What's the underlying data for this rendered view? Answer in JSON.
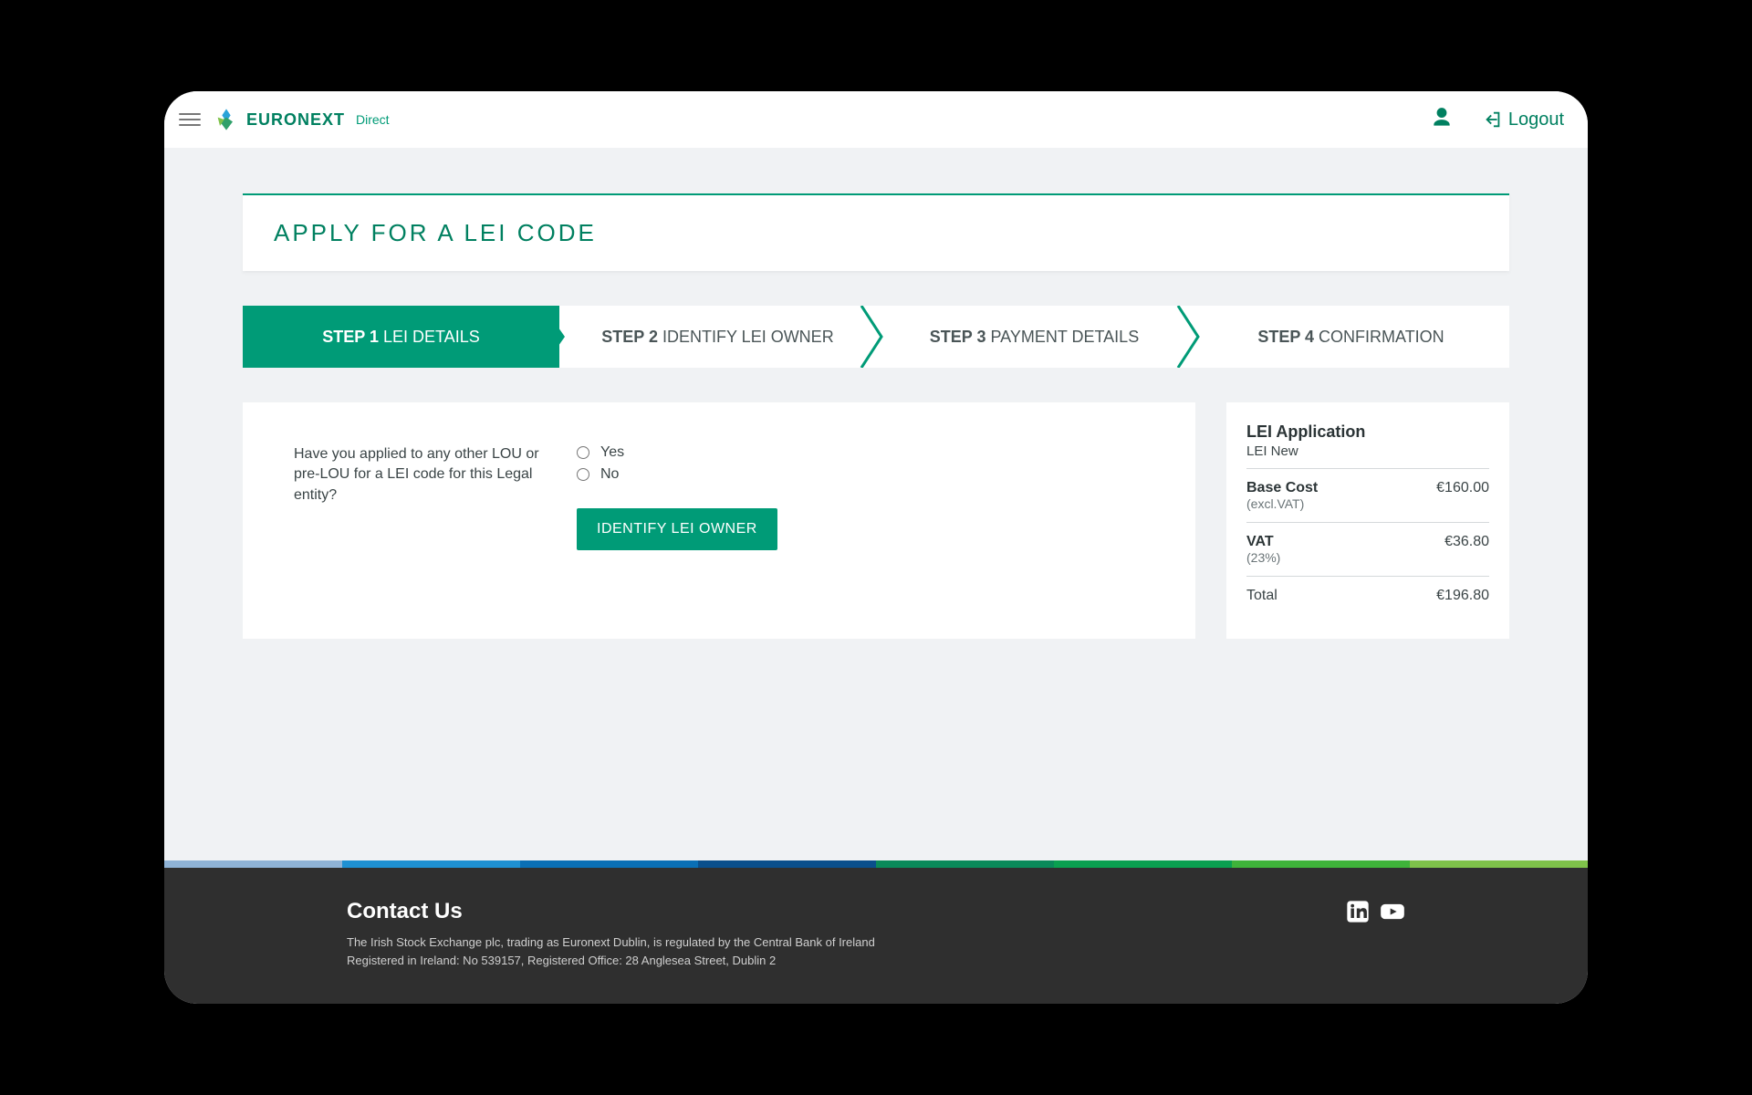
{
  "header": {
    "brand_name": "EURONEXT",
    "brand_sub": "Direct",
    "logout_label": "Logout"
  },
  "page": {
    "title": "APPLY FOR A LEI CODE"
  },
  "steps": [
    {
      "prefix": "STEP 1",
      "label": "LEI DETAILS"
    },
    {
      "prefix": "STEP 2",
      "label": "IDENTIFY LEI OWNER"
    },
    {
      "prefix": "STEP 3",
      "label": "PAYMENT DETAILS"
    },
    {
      "prefix": "STEP 4",
      "label": "CONFIRMATION"
    }
  ],
  "form": {
    "question": "Have you applied to any other LOU or pre-LOU for a LEI code for this Legal entity?",
    "option_yes": "Yes",
    "option_no": "No",
    "submit_label": "IDENTIFY LEI OWNER"
  },
  "summary": {
    "title": "LEI Application",
    "subtitle": "LEI New",
    "rows": [
      {
        "label": "Base Cost",
        "sub": "(excl.VAT)",
        "value": "€160.00"
      },
      {
        "label": "VAT",
        "sub": "(23%)",
        "value": "€36.80"
      },
      {
        "label": "Total",
        "sub": "",
        "value": "€196.80"
      }
    ]
  },
  "footer": {
    "contact_title": "Contact Us",
    "line1": "The Irish Stock Exchange plc, trading as Euronext Dublin, is regulated by the Central Bank of Ireland",
    "line2": "Registered in Ireland: No 539157, Registered Office: 28 Anglesea Street, Dublin 2",
    "strip_colors": [
      "#8fb3d6",
      "#1e90d2",
      "#0a6fb5",
      "#0a4f8c",
      "#0a8a5a",
      "#0aa050",
      "#3fb33a",
      "#7fc24a"
    ]
  }
}
